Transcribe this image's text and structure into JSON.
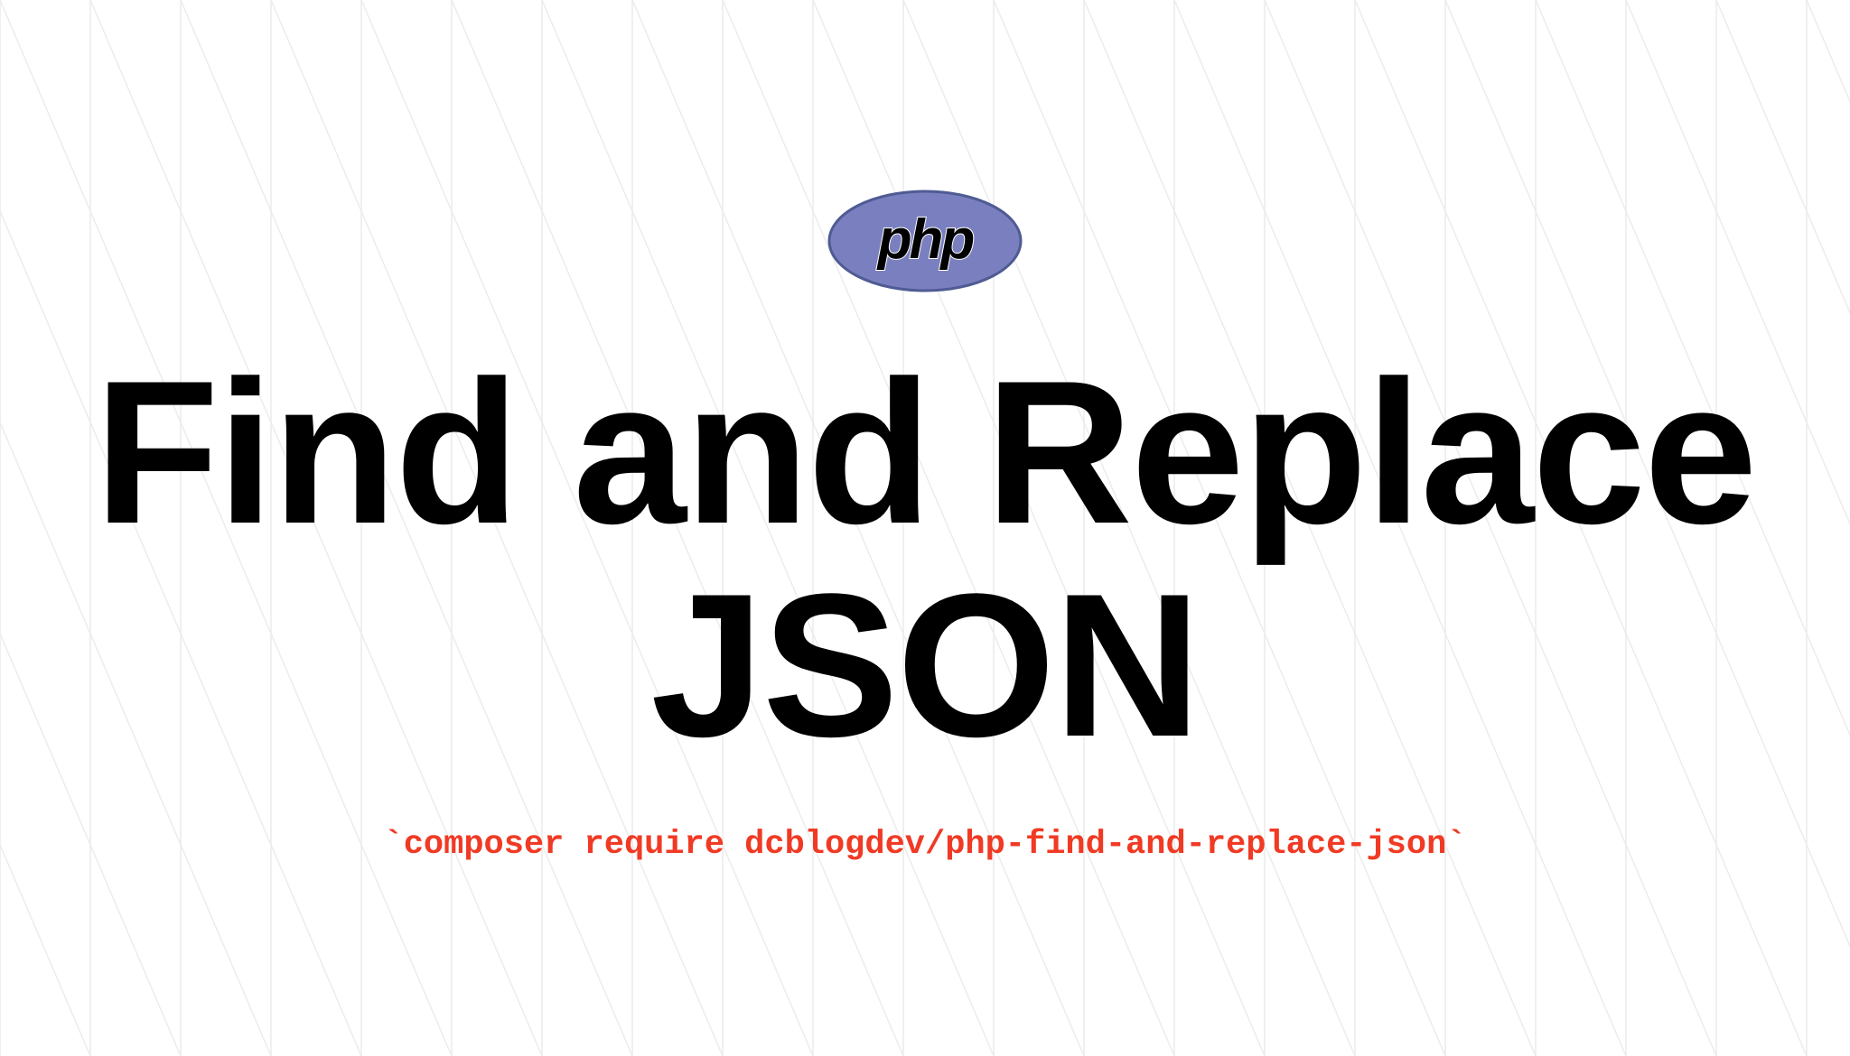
{
  "logo": {
    "text": "php",
    "colors": {
      "fill": "#7a80bf",
      "stroke": "#4f5b93",
      "text": "#000000"
    }
  },
  "title": {
    "line1": "Find and Replace",
    "line2": "JSON"
  },
  "command": {
    "text": "`composer require dcblogdev/php-find-and-replace-json`",
    "color": "#f03a24"
  },
  "background": {
    "color": "#ffffff",
    "line_color": "#ececec"
  }
}
